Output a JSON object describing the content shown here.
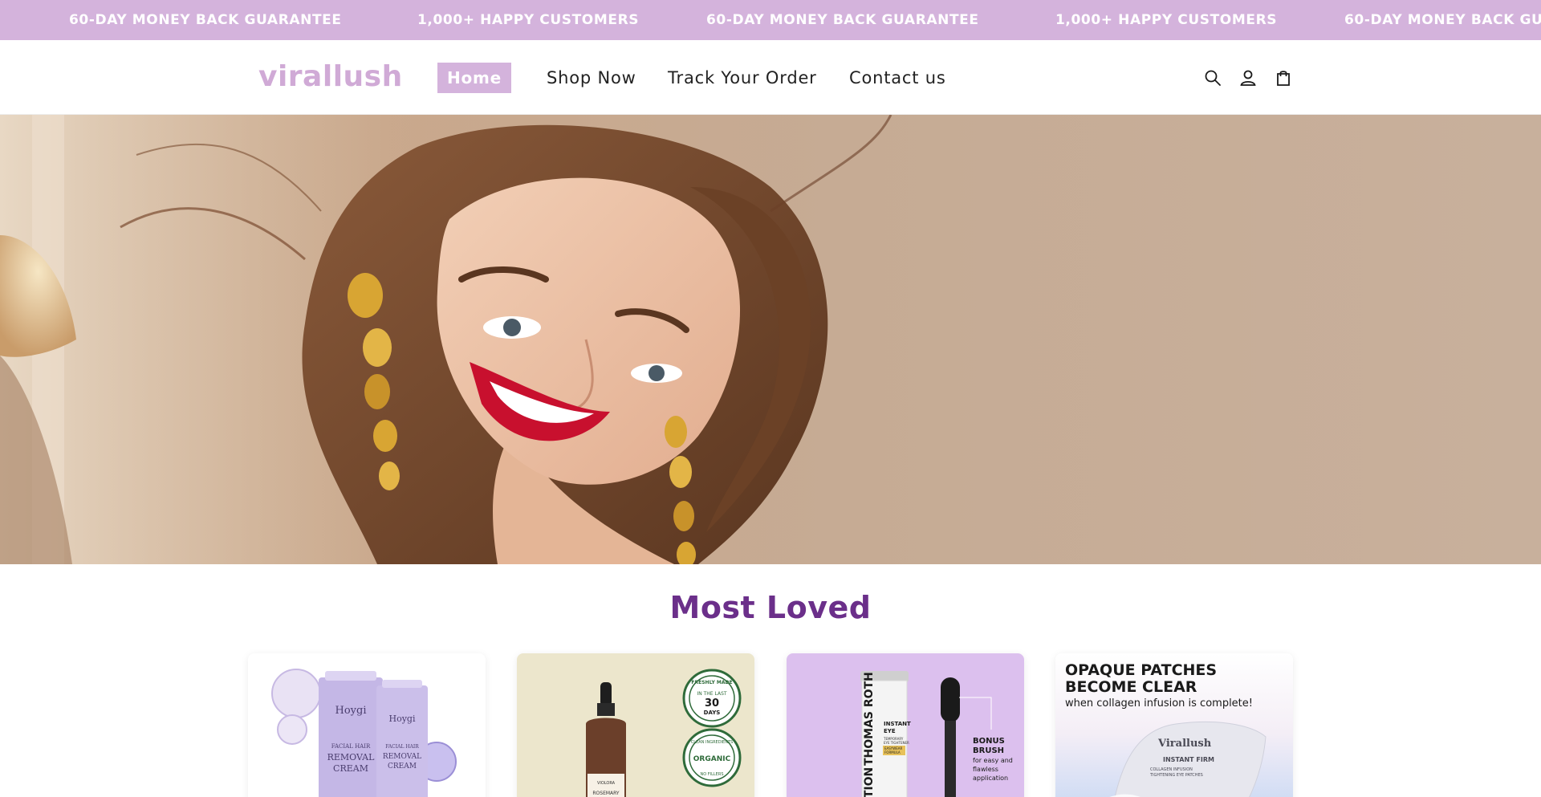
{
  "announcement": {
    "items": [
      "60-DAY MONEY BACK GUARANTEE",
      "1,000+ HAPPY CUSTOMERS",
      "60-DAY MONEY BACK GUARANTEE",
      "1,000+ HAPPY CUSTOMERS",
      "60-DAY MONEY BACK GUARANTEE"
    ]
  },
  "header": {
    "logo": "virallush",
    "nav": {
      "home": "Home",
      "shop": "Shop Now",
      "track": "Track Your Order",
      "contact": "Contact us"
    },
    "icons": [
      "search-icon",
      "account-icon",
      "cart-icon"
    ]
  },
  "section": {
    "title": "Most Loved"
  },
  "products": [
    {
      "brand": "Hoygi",
      "label_1": "FACIAL HAIR",
      "label_2": "REMOVAL",
      "label_3": "CREAM"
    },
    {
      "brand": "VIOLORA",
      "label": "ROSEMARY",
      "badge_1_top": "FRESHLY MADE",
      "badge_1_mid": "IN THE LAST",
      "badge_1_num": "30",
      "badge_1_unit": "DAYS",
      "badge_2_top": "CLEAN INGREDIENTS",
      "badge_2_mid": "ORGANIC",
      "badge_2_bot": "NO FILLERS"
    },
    {
      "brand": "THOMAS ROTH",
      "prefix": "ECTION",
      "product_1": "INSTANT",
      "product_2": "EYE",
      "product_3": "TEMPORARY",
      "product_4": "EYE TIGHTENER",
      "product_5": "EASYWEAR",
      "product_6": "FORMULA",
      "bonus_1": "BONUS",
      "bonus_2": "BRUSH",
      "bonus_3": "for easy and",
      "bonus_4": "flawless",
      "bonus_5": "application"
    },
    {
      "headline_1": "OPAQUE PATCHES",
      "headline_2": "BECOME CLEAR",
      "sub": "when collagen infusion is complete!",
      "brand": "Virallush",
      "product_1": "INSTANT FIRM",
      "product_2": "COLLAGEN INFUSION",
      "product_3": "TIGHTENING EYE PATCHES"
    }
  ],
  "colors": {
    "brand": "#d4b3dc",
    "title": "#6b2f8a",
    "lips": "#c8102e",
    "earrings": "#d8a533"
  }
}
